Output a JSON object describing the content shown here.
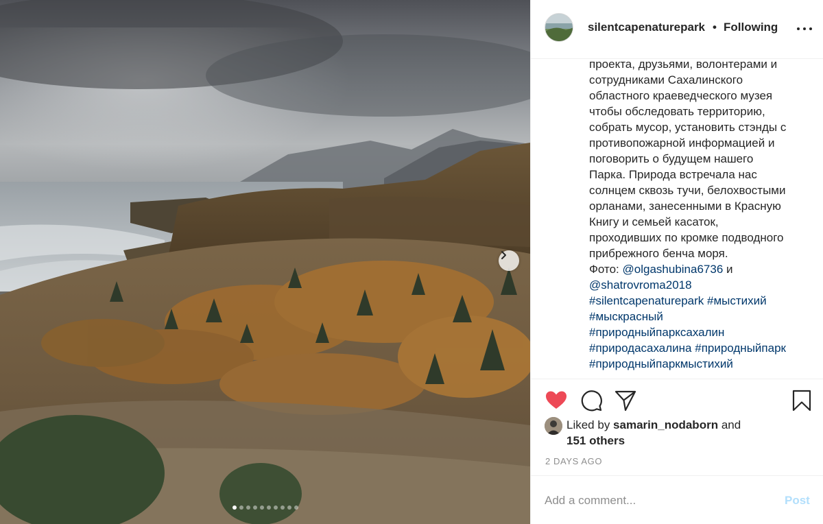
{
  "post": {
    "username": "silentcapenaturepark",
    "separator": "•",
    "follow_status": "Following",
    "caption_lines": [
      {
        "text": "проекта, друзьями, волонтерами и",
        "link": false
      },
      {
        "text": "сотрудниками Сахалинского",
        "link": false
      },
      {
        "text": "областного краеведческого музея",
        "link": false
      },
      {
        "text": "чтобы обследовать территорию,",
        "link": false
      },
      {
        "text": "собрать мусор, установить стэнды с",
        "link": false
      },
      {
        "text": "противопожарной информацией и",
        "link": false
      },
      {
        "text": "поговорить о будущем нашего",
        "link": false
      },
      {
        "text": "Парка. Природа встречала нас",
        "link": false
      },
      {
        "text": "солнцем сквозь тучи, белохвостыми",
        "link": false
      },
      {
        "text": "орланами, занесенными в Красную",
        "link": false
      },
      {
        "text": "Книгу и семьей касаток,",
        "link": false
      },
      {
        "text": "проходивших по кромке подводного",
        "link": false
      },
      {
        "text": "прибрежного бенча моря.",
        "link": false
      }
    ],
    "photo_credit": {
      "prefix": "Фото: ",
      "mention1": "@olgashubina6736",
      "conjunction": " и",
      "mention2": "@shatrovroma2018"
    },
    "hashtag_lines": [
      [
        "#silentcapenaturepark",
        "#мыстихий"
      ],
      [
        "#мыскрасный"
      ],
      [
        "#природныйпарксахалин"
      ],
      [
        "#природасахалина",
        "#природныйпарк"
      ],
      [
        "#природныйпаркмыстихий"
      ]
    ],
    "likes": {
      "prefix": "Liked by ",
      "user": "samarin_nodaborn",
      "middle": " and",
      "others": "151 others"
    },
    "timestamp": "2 DAYS AGO",
    "comment_placeholder": "Add a comment...",
    "post_button": "Post"
  },
  "carousel": {
    "slide_count": 10,
    "active_index": 0
  },
  "colors": {
    "like_red": "#ed4956",
    "link_blue": "#00376b",
    "post_disabled": "#b2dffc",
    "muted_gray": "#8e8e8e"
  },
  "icons": {
    "like": "heart-icon",
    "comment": "comment-icon",
    "share": "paper-plane-icon",
    "save": "bookmark-icon",
    "next": "chevron-right-icon",
    "more": "ellipsis-icon"
  }
}
